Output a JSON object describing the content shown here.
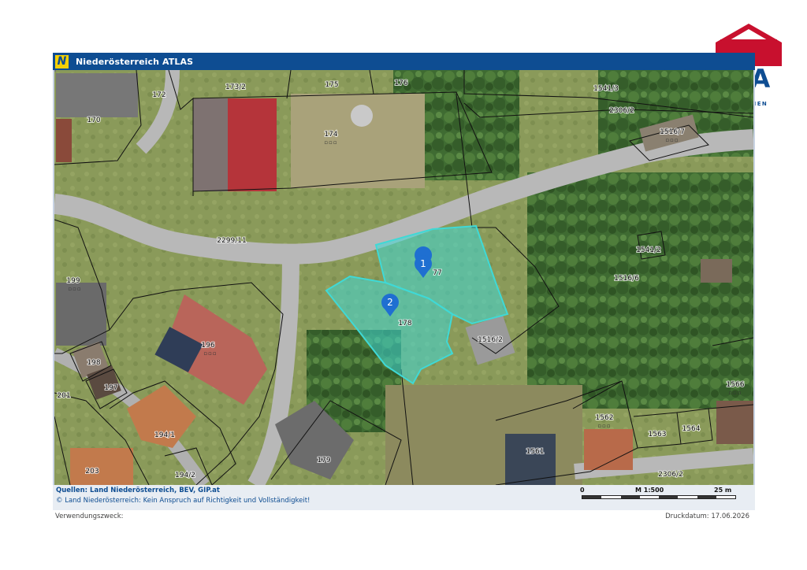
{
  "header": {
    "logo_letter": "N",
    "title": "Niederösterreich ATLAS"
  },
  "brand": {
    "name": "ERA",
    "tagline": "IMMOBILIEN",
    "roof_color": "#c8102e",
    "text_color": "#0e4d92"
  },
  "map": {
    "parcels": {
      "p172": "172",
      "p173_2": "173/2",
      "p175": "175",
      "p176": "176",
      "p1541_3": "1541/3",
      "p170": "170",
      "p174": "174",
      "p2306_2_top": "2306/2",
      "p1516_7": "1516/7",
      "p2299_11": "2299/11",
      "p1541_2": "1541/2",
      "p199": "199",
      "p177": "77",
      "p1516_6": "1516/6",
      "p178": "178",
      "p1516_2": "1516/2",
      "p196": "196",
      "p198": "198",
      "p197": "197",
      "p201": "201",
      "p1566": "1566",
      "p1562": "1562",
      "p1563": "1563",
      "p1564": "1564",
      "p194_1": "194/1",
      "p179": "179",
      "p1561": "1561",
      "p203": "203",
      "p194_2": "194/2",
      "p2306_2_bottom": "2306/2"
    },
    "markers": [
      {
        "id": "1",
        "color": "#1f6fd1"
      },
      {
        "id": "2",
        "color": "#1f6fd1"
      }
    ],
    "highlight_color": "#3fd9d6"
  },
  "footer": {
    "sources": "Quellen: Land Niederösterreich, BEV, GIP.at",
    "disclaimer": "© Land Niederösterreich: Kein Anspruch auf Richtigkeit und Vollständigkeit!",
    "scale_start": "0",
    "scale_ratio": "M 1:500",
    "scale_end": "25 m",
    "purpose": "Verwendungszweck:",
    "print_date": "Druckdatum: 17.06.2026"
  }
}
